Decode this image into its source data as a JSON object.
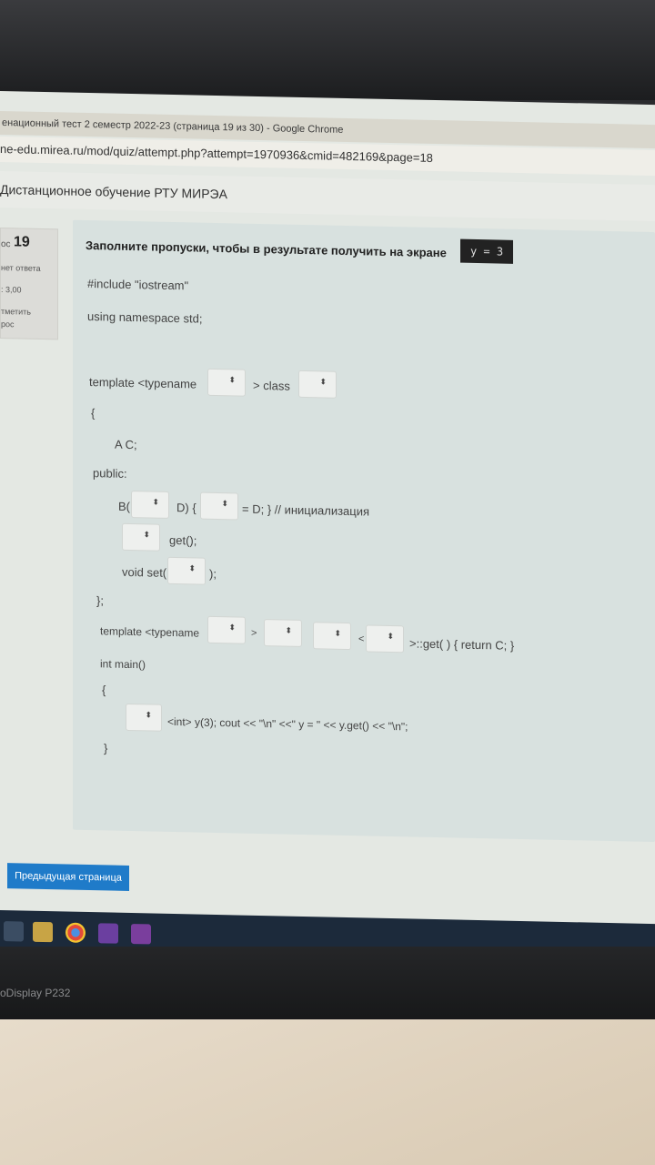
{
  "browser": {
    "title": "енационный тест 2 семестр 2022-23 (страница 19 из 30) - Google Chrome",
    "url": "ne-edu.mirea.ru/mod/quiz/attempt.php?attempt=1970936&cmid=482169&page=18"
  },
  "site": {
    "name": "Дистанционное обучение РТУ МИРЭА"
  },
  "question_info": {
    "label": "ос",
    "number": "19",
    "status": "нет ответа",
    "score": ": 3,00",
    "flag_line1": "тметить",
    "flag_line2": "рос"
  },
  "question": {
    "prompt": "Заполните пропуски, чтобы в результате получить на экране",
    "expected_output": "y = 3",
    "lines": {
      "include": "#include \"iostream\"",
      "using": "using namespace std;",
      "template1_a": "template <typename",
      "template1_b": "> class",
      "brace_open1": "{",
      "member": "A C;",
      "public": "public:",
      "ctor_a": "B(",
      "ctor_b": "D) {",
      "ctor_c": "= D; } // инициализация",
      "getter": "get();",
      "setter_a": "void set(",
      "setter_b": ");",
      "class_end": "};",
      "template2_a": "template <typename",
      "template2_b": ">",
      "template2_c": "<",
      "template2_d": ">::get( ) { return C; }",
      "main": "int main()",
      "brace_open2": "{",
      "main_body_a": "<int> y(3); cout << \"\\n\" <<\" y = \" << y.get() << \"\\n\";",
      "brace_close2": "}"
    },
    "dropdown_arrow": "⬍"
  },
  "nav": {
    "prev_button": "Предыдущая страница"
  },
  "monitor": {
    "brand": "oDisplay P232"
  }
}
